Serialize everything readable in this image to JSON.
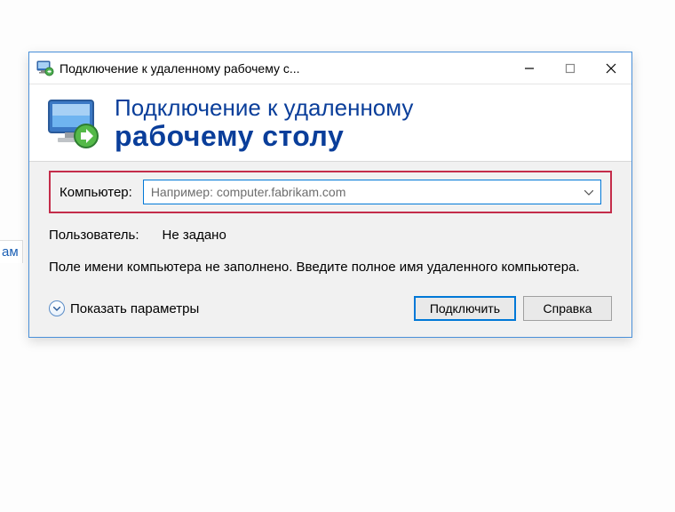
{
  "bg": {
    "link_fragment": "ам"
  },
  "titlebar": {
    "title": "Подключение к удаленному рабочему с..."
  },
  "banner": {
    "line1": "Подключение к удаленному",
    "line2": "рабочему столу"
  },
  "body": {
    "computer_label": "Компьютер:",
    "computer_placeholder": "Например: computer.fabrikam.com",
    "user_label": "Пользователь:",
    "user_value": "Не задано",
    "hint": "Поле имени компьютера не заполнено. Введите полное имя удаленного компьютера."
  },
  "footer": {
    "expand_label": "Показать параметры",
    "connect": "Подключить",
    "help": "Справка"
  }
}
